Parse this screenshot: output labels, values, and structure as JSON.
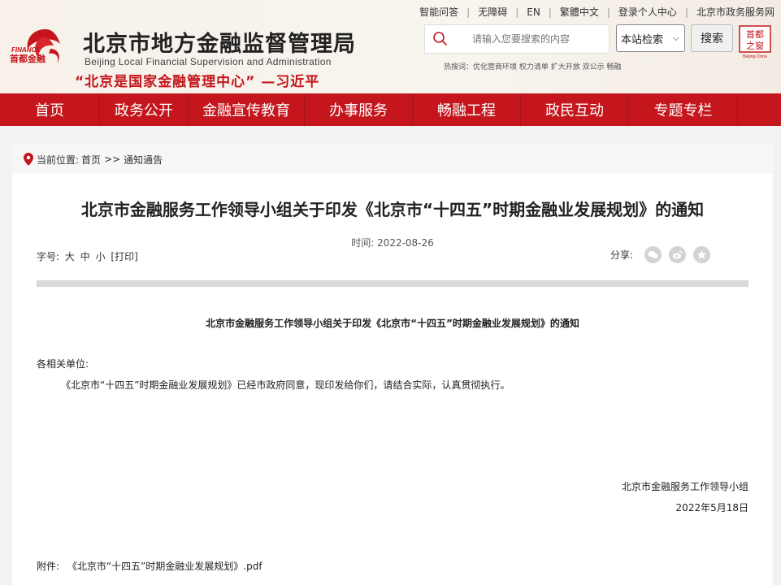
{
  "topnav": {
    "items": [
      "智能问答",
      "无障碍",
      "EN",
      "繁體中文",
      "登录个人中心",
      "北京市政务服务网"
    ]
  },
  "branding": {
    "logo_text_en": "FINANCE",
    "logo_text_cn": "首都金融",
    "site_title": "北京市地方金融监督管理局",
    "site_title_en": "Beijing Local Financial Supervision and Administration",
    "slogan": "“北京是国家金融管理中心” —习近平",
    "badge_top": "首都",
    "badge_mid": "之窗",
    "badge_bottom": "Beijing-China"
  },
  "search": {
    "placeholder": "请输入您要搜索的内容",
    "scope_value": "本站检索",
    "button_label": "搜索",
    "hotwords": "热搜词：优化营商环境  权力清单  扩大开放  双公示  畅融"
  },
  "mainnav": {
    "items": [
      "首页",
      "政务公开",
      "金融宣传教育",
      "办事服务",
      "畅融工程",
      "政民互动",
      "专题专栏"
    ]
  },
  "breadcrumb": {
    "label": "当前位置:",
    "home": "首页",
    "sep": ">>",
    "current": "通知通告"
  },
  "article": {
    "title": "北京市金融服务工作领导小组关于印发《北京市“十四五”时期金融业发展规划》的通知",
    "date_label": "时间: ",
    "date": "2022-08-26",
    "font_size_label": "字号:",
    "font_large": "大",
    "font_medium": "中",
    "font_small": "小",
    "print": "[打印]",
    "share_label": "分享:",
    "doc_title": "北京市金融服务工作领导小组关于印发《北京市“十四五”时期金融业发展规划》的通知",
    "recipient": "各相关单位:",
    "body": "《北京市“十四五”时期金融业发展规划》已经市政府同意，现印发给你们，请结合实际，认真贯彻执行。",
    "signer": "北京市金融服务工作领导小组",
    "sign_date": "2022年5月18日",
    "attachment_label": "附件:",
    "attachment_name": "《北京市“十四五”时期金融业发展规划》.pdf"
  },
  "colors": {
    "brand_red": "#c4161c",
    "divider_gray": "#d9d9d9"
  }
}
